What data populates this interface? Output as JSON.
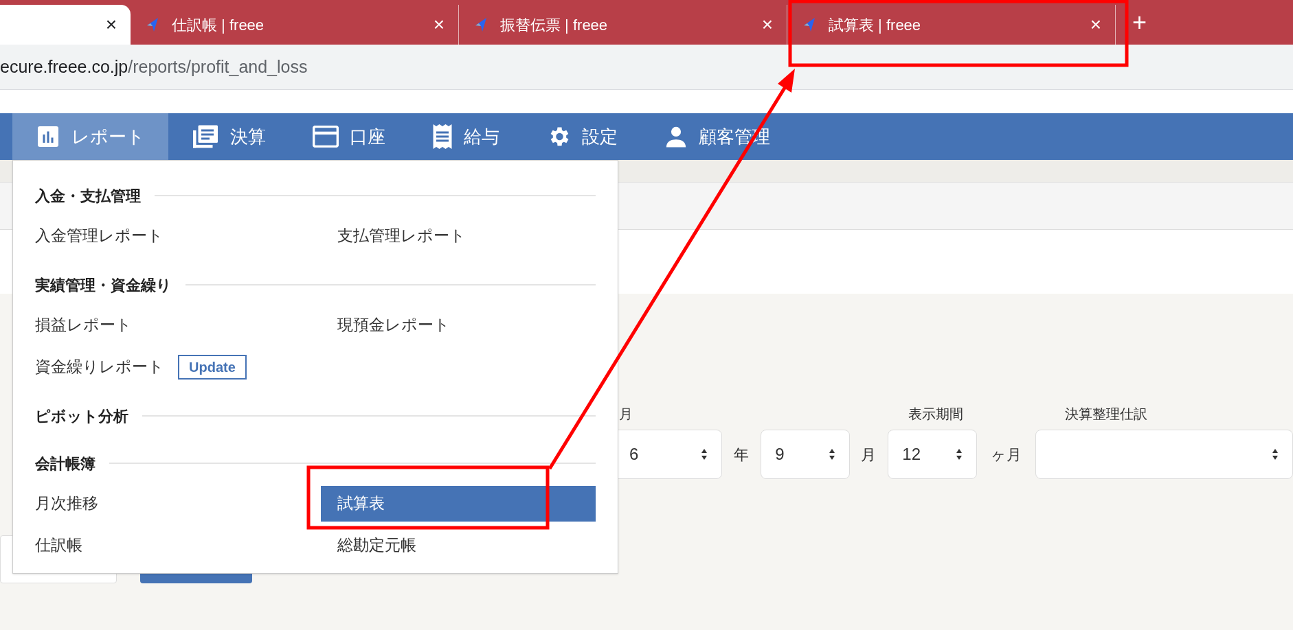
{
  "browser": {
    "tabs": [
      {
        "selected": true,
        "close": "×"
      },
      {
        "title": "仕訳帳 | freee",
        "selected": false,
        "close": "×"
      },
      {
        "title": "振替伝票 | freee",
        "selected": false,
        "close": "×"
      },
      {
        "title": "試算表 | freee",
        "selected": false,
        "close": "×"
      }
    ],
    "new_tab": "+",
    "url": {
      "host": "ecure.freee.co.jp",
      "path": "/reports/profit_and_loss"
    }
  },
  "nav": {
    "items": [
      {
        "kind": "chart",
        "label": "レポート",
        "selected": true
      },
      {
        "kind": "book",
        "label": "決算",
        "selected": false
      },
      {
        "kind": "card",
        "label": "口座",
        "selected": false
      },
      {
        "kind": "receipt",
        "label": "給与",
        "selected": false
      },
      {
        "kind": "gear",
        "label": "設定",
        "selected": false
      },
      {
        "kind": "person",
        "label": "顧客管理",
        "selected": false
      }
    ]
  },
  "menu": {
    "sections": [
      {
        "heading": "入金・支払管理",
        "items": [
          {
            "label": "入金管理レポート",
            "selected": false
          },
          {
            "label": "支払管理レポート",
            "selected": false
          }
        ]
      },
      {
        "heading": "実績管理・資金繰り",
        "items": [
          {
            "label": "損益レポート",
            "selected": false
          },
          {
            "label": "現預金レポート",
            "selected": false
          },
          {
            "label": "資金繰りレポート",
            "selected": false,
            "badge": "Update"
          }
        ]
      },
      {
        "heading": "ピボット分析"
      },
      {
        "heading": "会計帳簿",
        "items": [
          {
            "label": "月次推移",
            "selected": false
          },
          {
            "label": "試算表",
            "selected": true
          },
          {
            "label": "仕訳帳",
            "selected": false
          },
          {
            "label": "総勘定元帳",
            "selected": false
          }
        ]
      }
    ]
  },
  "form": {
    "year_label": "月",
    "year": "6",
    "year_unit": "年",
    "month": "9",
    "month_unit": "月",
    "period_label": "表示期間",
    "period": "12",
    "period_unit": "ヶ月",
    "adjust_label": "決算整理仕訳"
  }
}
